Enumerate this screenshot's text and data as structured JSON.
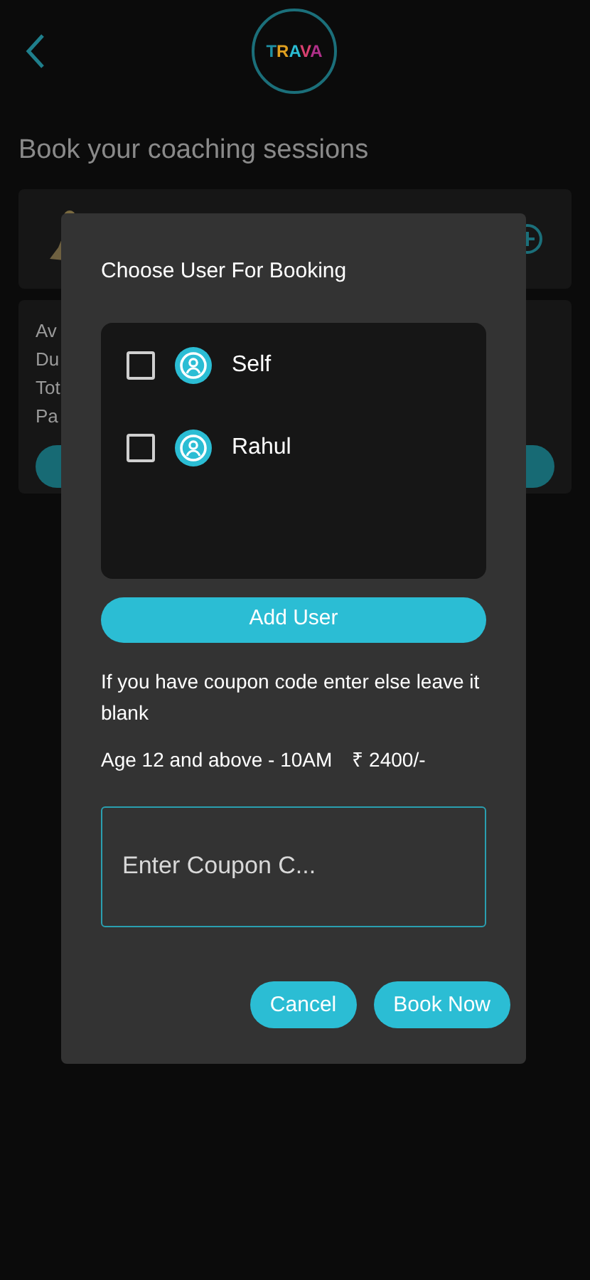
{
  "header": {
    "logo": "TRAVA"
  },
  "title": "Book your coaching sessions",
  "package_card": {
    "details": [
      "Av",
      "Du",
      "Tot",
      "Pa"
    ]
  },
  "dialog": {
    "title": "Choose User For Booking",
    "users": [
      {
        "name": "Self",
        "checked": false
      },
      {
        "name": "Rahul",
        "checked": false
      }
    ],
    "add_user": "Add User",
    "note": "If you have coupon code enter else leave it blank",
    "session": "Age 12 and above - 10AM",
    "price": "₹ 2400/-",
    "coupon": {
      "placeholder": "Enter Coupon C..."
    },
    "buttons": [
      {
        "label": "Cancel"
      },
      {
        "label": "Book Now"
      }
    ]
  }
}
